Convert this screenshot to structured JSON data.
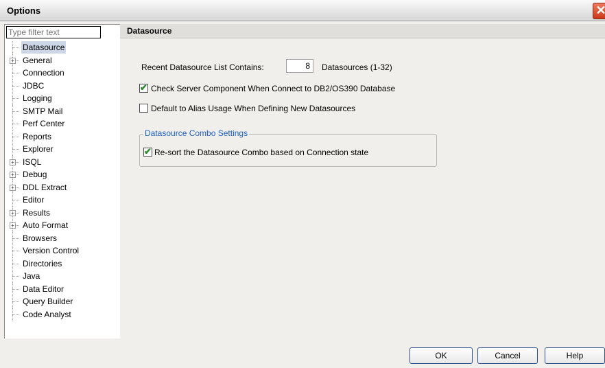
{
  "window": {
    "title": "Options"
  },
  "filter": {
    "placeholder": "Type filter text"
  },
  "tree": [
    {
      "label": "Datasource",
      "expandable": false,
      "selected": true
    },
    {
      "label": "General",
      "expandable": true
    },
    {
      "label": "Connection",
      "expandable": false
    },
    {
      "label": "JDBC",
      "expandable": false
    },
    {
      "label": "Logging",
      "expandable": false
    },
    {
      "label": "SMTP Mail",
      "expandable": false
    },
    {
      "label": "Perf Center",
      "expandable": false
    },
    {
      "label": "Reports",
      "expandable": false
    },
    {
      "label": "Explorer",
      "expandable": false
    },
    {
      "label": "ISQL",
      "expandable": true
    },
    {
      "label": "Debug",
      "expandable": true
    },
    {
      "label": "DDL Extract",
      "expandable": true
    },
    {
      "label": "Editor",
      "expandable": false
    },
    {
      "label": "Results",
      "expandable": true
    },
    {
      "label": "Auto Format",
      "expandable": true
    },
    {
      "label": "Browsers",
      "expandable": false
    },
    {
      "label": "Version Control",
      "expandable": false
    },
    {
      "label": "Directories",
      "expandable": false
    },
    {
      "label": "Java",
      "expandable": false
    },
    {
      "label": "Data Editor",
      "expandable": false
    },
    {
      "label": "Query Builder",
      "expandable": false
    },
    {
      "label": "Code Analyst",
      "expandable": false
    }
  ],
  "section": {
    "title": "Datasource",
    "recent_label": "Recent Datasource List Contains:",
    "recent_value": "8",
    "recent_suffix": "Datasources (1-32)",
    "check_server_label": "Check Server Component When Connect to DB2/OS390 Database",
    "check_server_checked": true,
    "alias_label": "Default to Alias Usage When Defining New Datasources",
    "alias_checked": false,
    "group_title": "Datasource Combo Settings",
    "resort_label": "Re-sort the Datasource Combo based on Connection state",
    "resort_checked": true
  },
  "buttons": {
    "ok": "OK",
    "cancel": "Cancel",
    "help": "Help"
  },
  "icons": {
    "close": "close-icon",
    "check": "check-icon",
    "expander": "plus-expander-icon"
  }
}
